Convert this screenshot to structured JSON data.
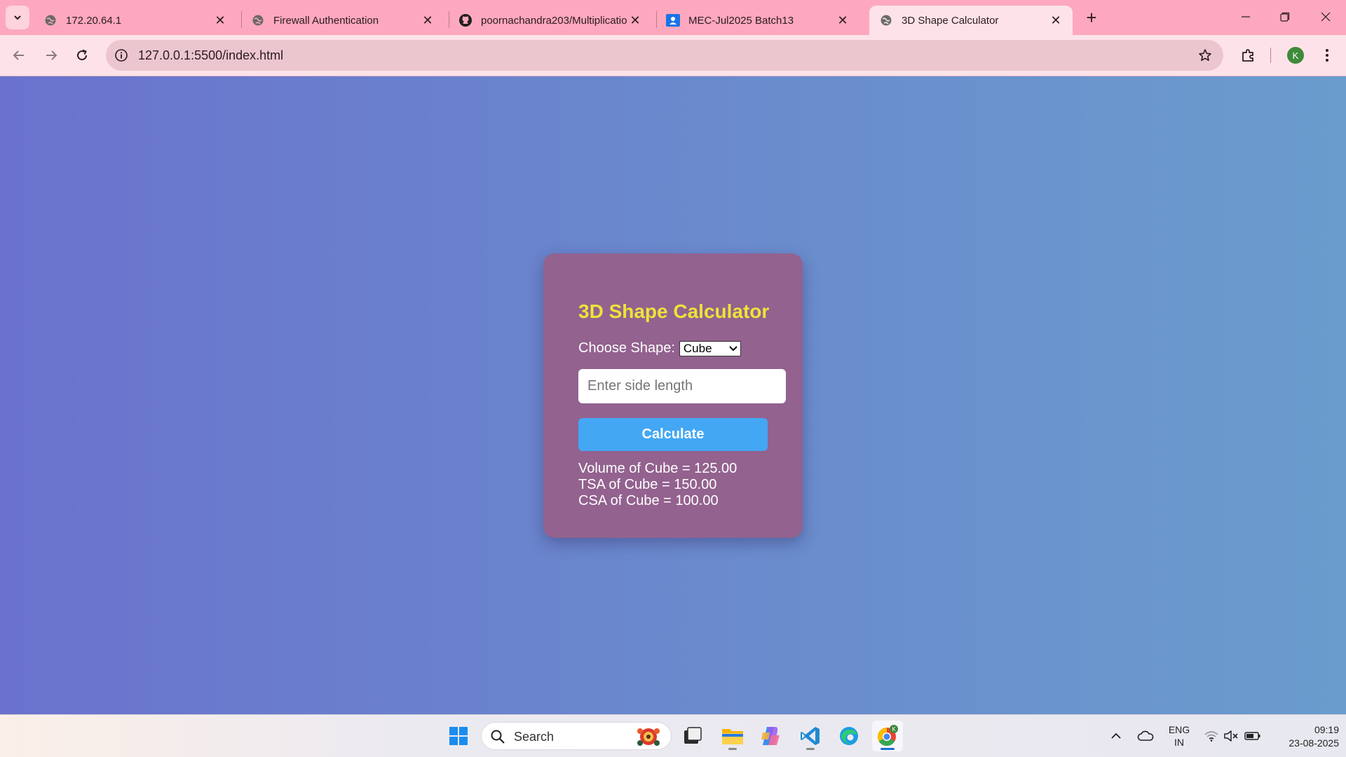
{
  "browser": {
    "tabs": [
      {
        "title": "172.20.64.1",
        "icon": "globe-icon",
        "active": false
      },
      {
        "title": "Firewall Authentication",
        "icon": "globe-icon",
        "active": false
      },
      {
        "title": "poornachandra203/Multiplicatio",
        "icon": "github-icon",
        "active": false
      },
      {
        "title": "MEC-Jul2025 Batch13",
        "icon": "classroom-icon",
        "active": false
      },
      {
        "title": "3D Shape Calculator",
        "icon": "globe-icon",
        "active": true
      }
    ],
    "url": "127.0.0.1:5500/index.html",
    "profile_initial": "K"
  },
  "page": {
    "title": "3D Shape Calculator",
    "shape_label": "Choose Shape:",
    "shape_selected": "Cube",
    "input_placeholder": "Enter side length",
    "button_label": "Calculate",
    "results": [
      "Volume of Cube = 125.00",
      "TSA of Cube = 150.00",
      "CSA of Cube = 100.00"
    ]
  },
  "taskbar": {
    "search_label": "Search",
    "language_line1": "ENG",
    "language_line2": "IN",
    "time": "09:19",
    "date": "23-08-2025"
  },
  "colors": {
    "tab_strip": "#fda8be",
    "toolbar": "#fde3e9",
    "card": "#93628f",
    "title": "#ebe43a",
    "button": "#43a7f4"
  }
}
